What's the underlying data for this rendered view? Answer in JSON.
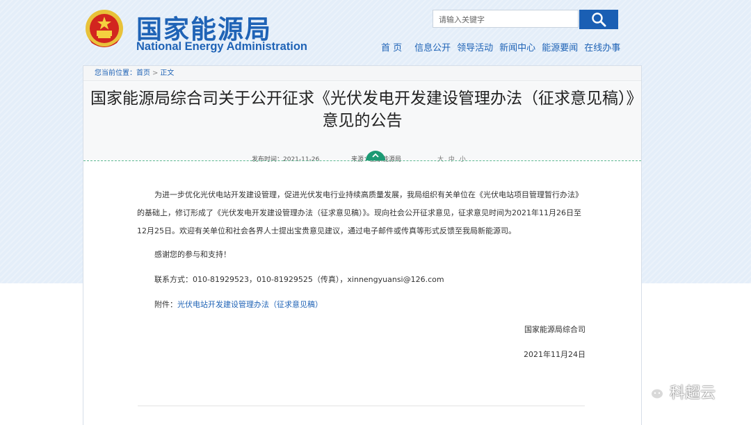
{
  "header": {
    "title_cn": "国家能源局",
    "title_en": "National Energy Administration",
    "emblem_icon": "national-emblem-icon",
    "search": {
      "placeholder": "请输入关键字",
      "icon": "search-icon"
    },
    "nav": [
      "首 页",
      "信息公开",
      "领导活动",
      "新闻中心",
      "能源要闻",
      "在线办事"
    ]
  },
  "breadcrumb": {
    "prefix": "您当前位置：",
    "home": "首页",
    "separator": ">",
    "current": "正文"
  },
  "article": {
    "title": "国家能源局综合司关于公开征求《光伏发电开发建设管理办法（征求意见稿）》意见的公告",
    "publish": "发布时间：2021-11-26",
    "source": "来源：国家能源局",
    "font_sizes": "大 中 小",
    "paragraph1": "为进一步优化光伏电站开发建设管理，促进光伏发电行业持续高质量发展，我局组织有关单位在《光伏电站项目管理暂行办法》的基础上，修订形成了《光伏发电开发建设管理办法（征求意见稿）》。现向社会公开征求意见，征求意见时间为2021年11月26日至12月25日。欢迎有关单位和社会各界人士提出宝贵意见建议，通过电子邮件或传真等形式反馈至我局新能源司。",
    "thanks": "感谢您的参与和支持！",
    "contact": "联系方式：010-81929523，010-81929525（传真），xinnengyuansi@126.com",
    "attachment_label": "附件：",
    "attachment_link": "光伏电站开发建设管理办法（征求意见稿）",
    "signature": "国家能源局综合司",
    "date": "2021年11月24日"
  },
  "watermark": {
    "text": "科超云",
    "icon": "wechat-icon"
  },
  "colors": {
    "brand_blue": "#1f63b6",
    "accent_green": "#1c9a74",
    "header_bg": "#e4eef9"
  }
}
